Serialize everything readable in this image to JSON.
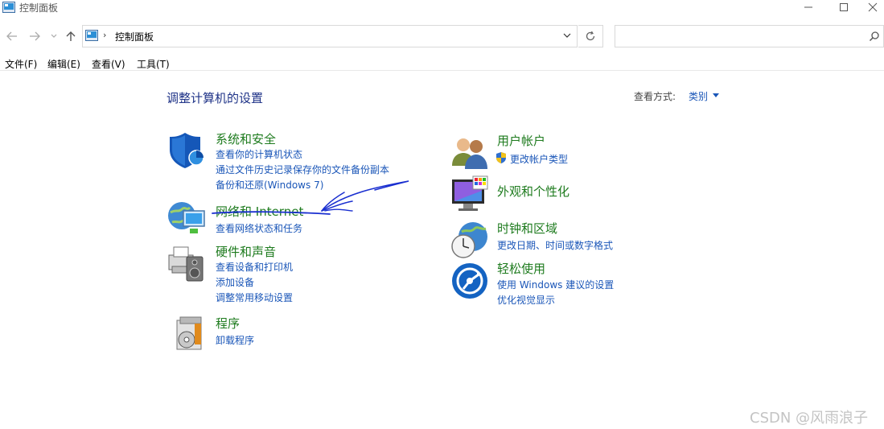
{
  "window": {
    "title": "控制面板",
    "minimize_icon": "minimize-icon",
    "maximize_icon": "maximize-icon",
    "close_icon": "close-icon"
  },
  "nav": {
    "address_crumb": "控制面板",
    "search_placeholder": ""
  },
  "menu": [
    "文件(F)",
    "编辑(E)",
    "查看(V)",
    "工具(T)"
  ],
  "main": {
    "heading": "调整计算机的设置",
    "view_by_label": "查看方式:",
    "view_by_value": "类别"
  },
  "categories": {
    "system_security": {
      "title": "系统和安全",
      "links": [
        "查看你的计算机状态",
        "通过文件历史记录保存你的文件备份副本",
        "备份和还原(Windows 7)"
      ]
    },
    "network": {
      "title": "网络和 Internet",
      "links": [
        "查看网络状态和任务"
      ]
    },
    "hardware": {
      "title": "硬件和声音",
      "links": [
        "查看设备和打印机",
        "添加设备",
        "调整常用移动设置"
      ]
    },
    "programs": {
      "title": "程序",
      "links": [
        "卸载程序"
      ]
    },
    "user_accounts": {
      "title": "用户帐户",
      "links": [
        "更改帐户类型"
      ]
    },
    "appearance": {
      "title": "外观和个性化",
      "links": []
    },
    "clock_region": {
      "title": "时钟和区域",
      "links": [
        "更改日期、时间或数字格式"
      ]
    },
    "ease": {
      "title": "轻松使用",
      "links": [
        "使用 Windows 建议的设置",
        "优化视觉显示"
      ]
    }
  },
  "watermark": "CSDN @风雨浪子",
  "colors": {
    "category_title": "#1e7b1e",
    "link": "#1a56b8",
    "heading": "#1e3287",
    "annotation_ink": "#1a2fd0"
  }
}
